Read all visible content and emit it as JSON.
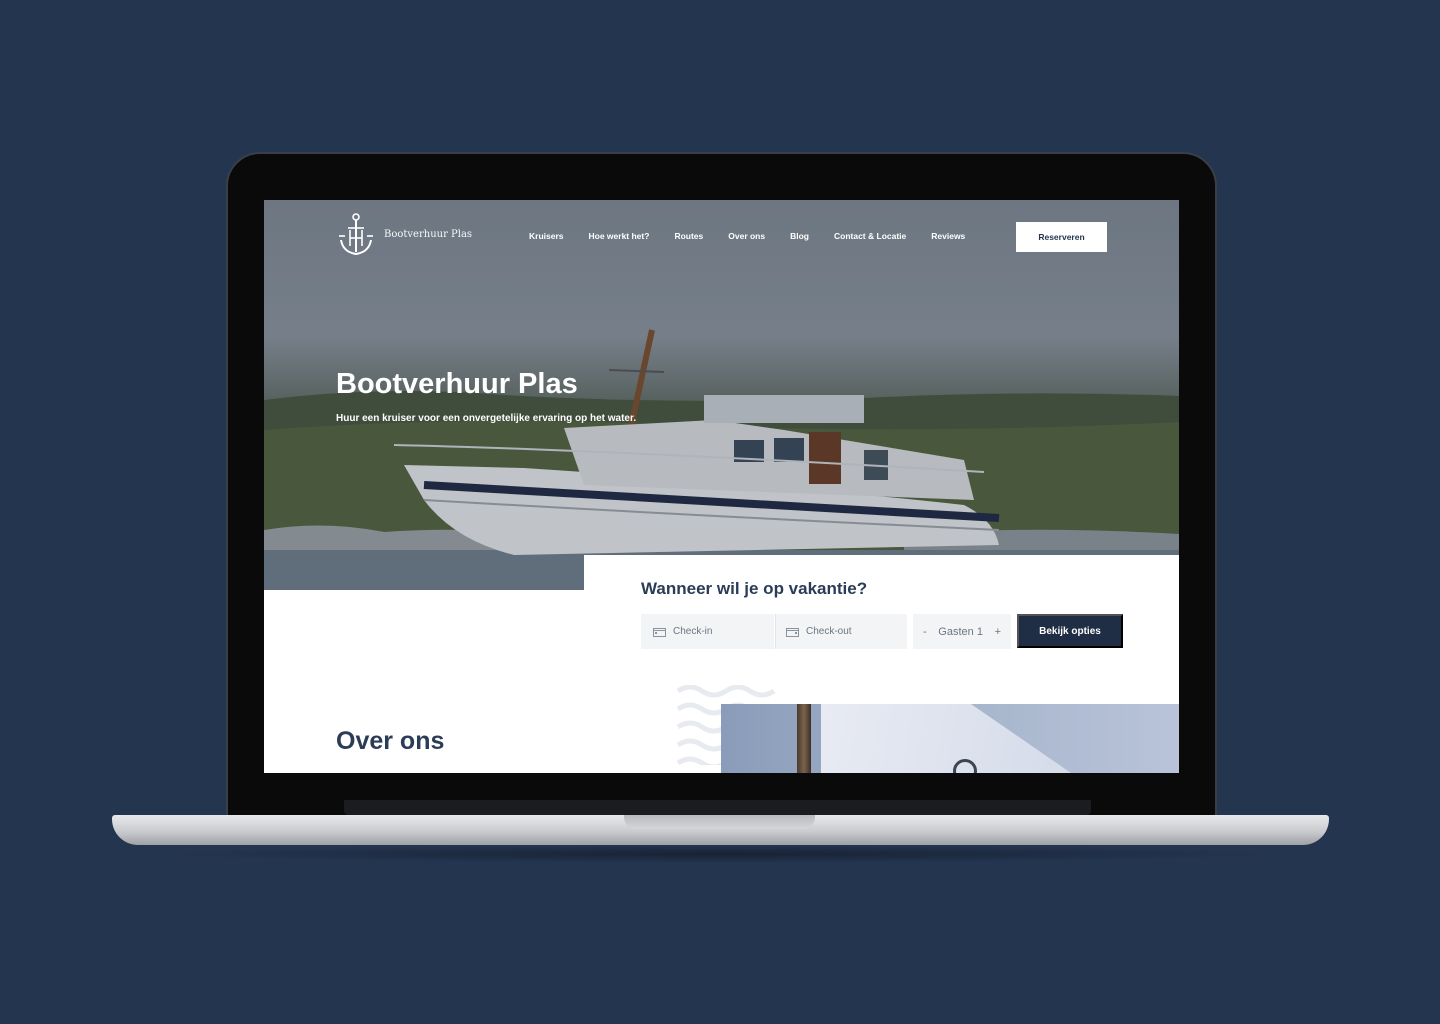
{
  "brand": {
    "name": "Bootverhuur Plas"
  },
  "nav": {
    "items": [
      "Kruisers",
      "Hoe werkt het?",
      "Routes",
      "Over ons",
      "Blog",
      "Contact & Locatie",
      "Reviews"
    ],
    "cta": "Reserveren"
  },
  "hero": {
    "title": "Bootverhuur Plas",
    "subtitle": "Huur een kruiser voor een onvergetelijke ervaring op het water."
  },
  "booking": {
    "title": "Wanneer wil je op vakantie?",
    "checkin": "Check-in",
    "checkout": "Check-out",
    "guests_label": "Gasten 1",
    "minus": "-",
    "plus": "+",
    "submit": "Bekijk opties"
  },
  "about": {
    "title": "Over ons"
  },
  "icons": {
    "logo": "anchor-logo-icon",
    "checkin": "calendar-icon",
    "checkout": "calendar-icon",
    "decoration": "waves-icon"
  },
  "colors": {
    "background": "#243550",
    "primary": "#1f2d45",
    "heading": "#2c3c57"
  }
}
